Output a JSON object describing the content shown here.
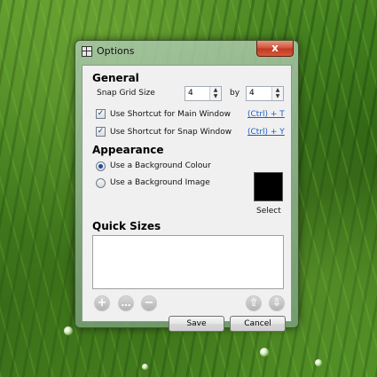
{
  "window": {
    "title": "Options",
    "close_glyph": "x"
  },
  "general": {
    "heading": "General",
    "snap_grid_label": "Snap Grid Size",
    "snap_x": "4",
    "by_label": "by",
    "snap_y": "4",
    "shortcut_main_label": "Use Shortcut for Main Window",
    "shortcut_main_checked": true,
    "shortcut_main_key": "(Ctrl) + T",
    "shortcut_snap_label": "Use Shortcut for Snap Window",
    "shortcut_snap_checked": true,
    "shortcut_snap_key": "(Ctrl) + Y"
  },
  "appearance": {
    "heading": "Appearance",
    "bg_colour_label": "Use a Background Colour",
    "bg_colour_selected": true,
    "bg_image_label": "Use a Background Image",
    "swatch_color": "#000000",
    "select_label": "Select"
  },
  "quick_sizes": {
    "heading": "Quick Sizes",
    "items": [],
    "add_icon": "plus-icon",
    "more_icon": "ellipsis-icon",
    "remove_icon": "minus-icon",
    "up_icon": "arrow-up-icon",
    "down_icon": "arrow-down-icon"
  },
  "buttons": {
    "save": "Save",
    "cancel": "Cancel"
  },
  "glyphs": {
    "check": "✓",
    "spin_up": "▲",
    "spin_down": "▼",
    "plus": "+",
    "more": "…",
    "minus": "−",
    "up": "⇧",
    "down": "⇩"
  }
}
